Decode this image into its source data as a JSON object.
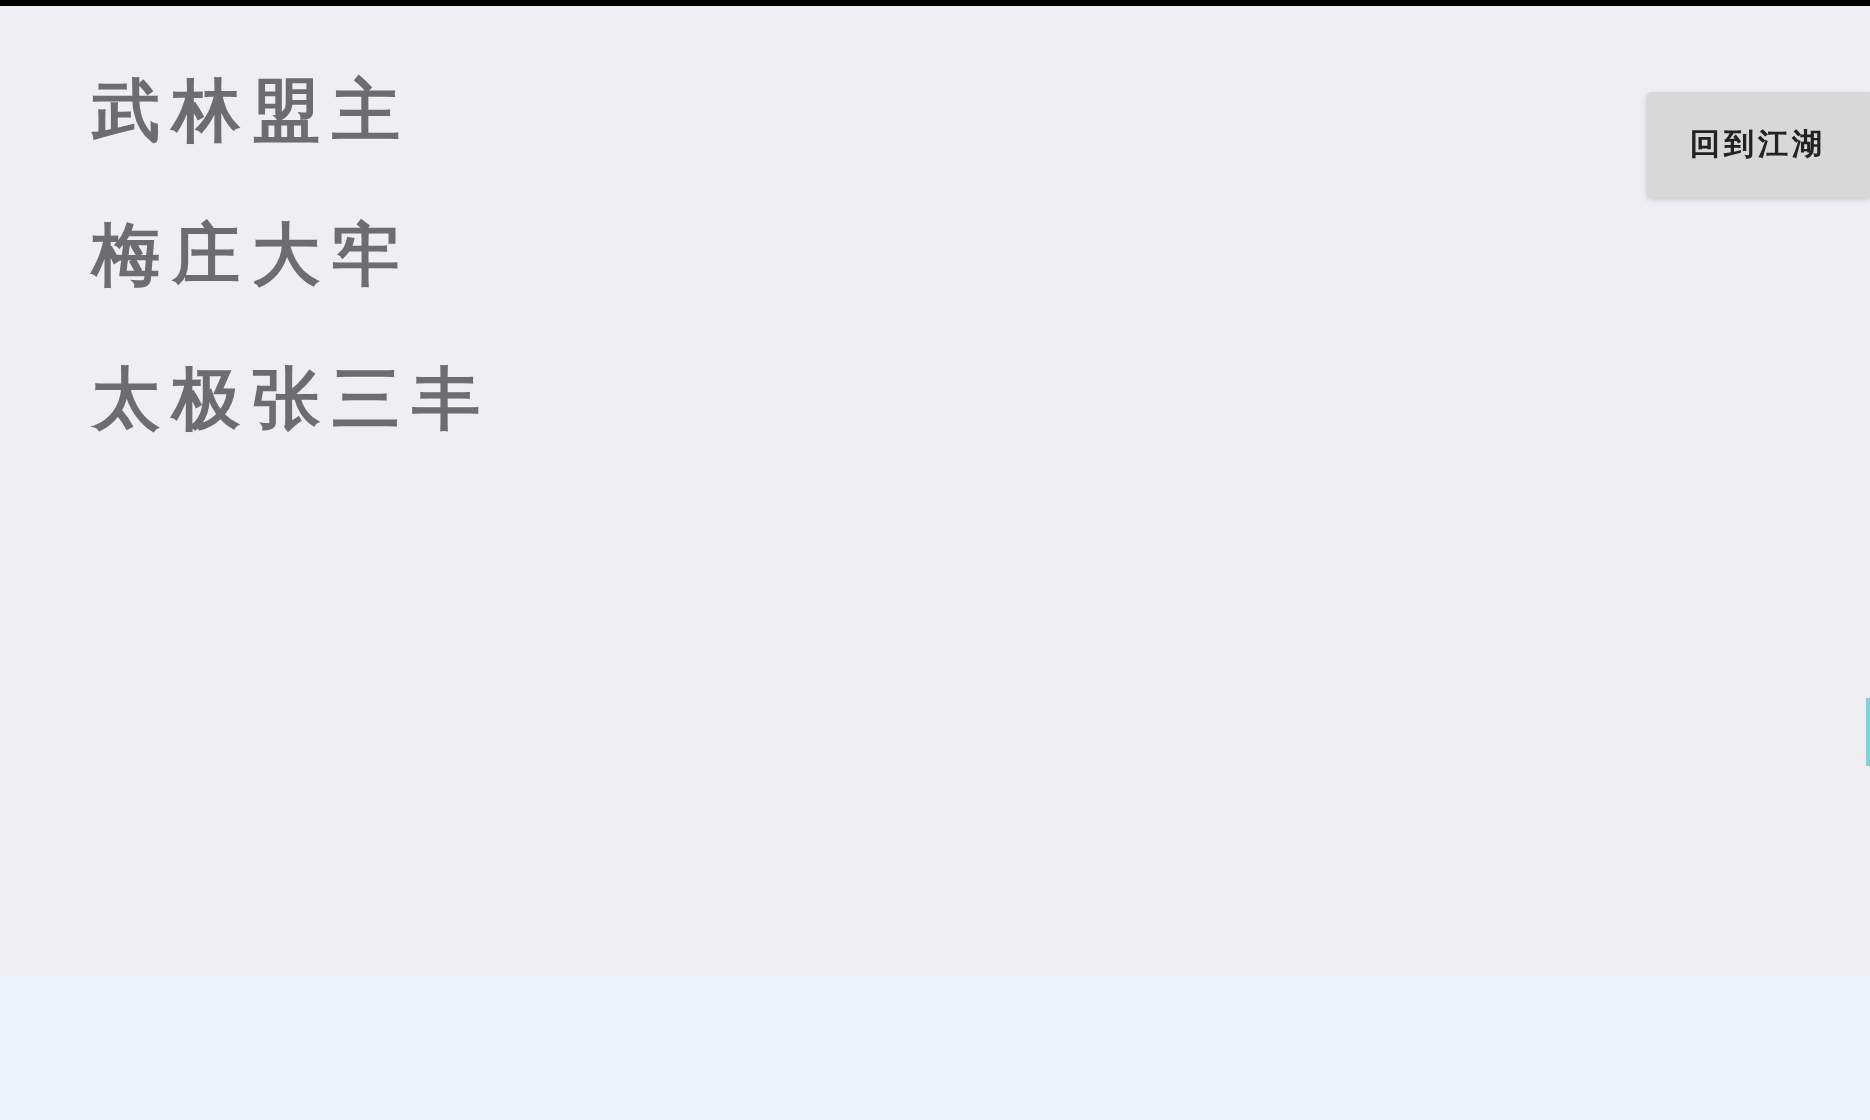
{
  "menu": [
    {
      "label": "武林盟主"
    },
    {
      "label": "梅庄大牢"
    },
    {
      "label": "太极张三丰"
    }
  ],
  "back_button": {
    "label": "回到江湖"
  }
}
